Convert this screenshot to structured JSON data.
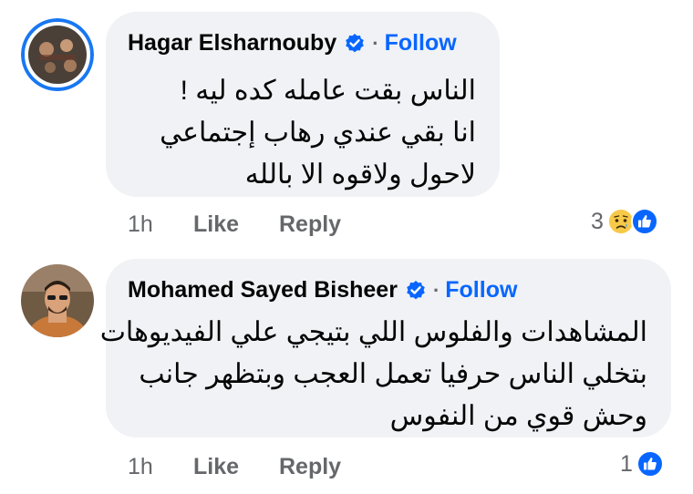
{
  "comments": [
    {
      "author": "Hagar Elsharnouby",
      "follow_label": "Follow",
      "separator": "·",
      "lines": [
        "الناس بقت عامله كده ليه !",
        "انا بقي عندي رهاب  إجتماعي",
        "لاحول ولاقوه الا بالله"
      ],
      "time": "1h",
      "like_label": "Like",
      "reply_label": "Reply",
      "reaction_count": "3",
      "reaction_icons": [
        "sad-icon",
        "like-icon"
      ]
    },
    {
      "author": "Mohamed Sayed Bisheer",
      "follow_label": "Follow",
      "separator": "·",
      "lines": [
        "المشاهدات والفلوس اللي بتيجي علي الفيديوهات",
        "بتخلي الناس حرفيا تعمل العجب وبتظهر جانب",
        "وحش قوي من النفوس"
      ],
      "time": "1h",
      "like_label": "Like",
      "reply_label": "Reply",
      "reaction_count": "1",
      "reaction_icons": [
        "like-icon"
      ]
    }
  ],
  "colors": {
    "bubble": "#f0f2f5",
    "follow": "#0866ff",
    "meta": "#65676b",
    "avatar_ring": "#1877f2"
  }
}
